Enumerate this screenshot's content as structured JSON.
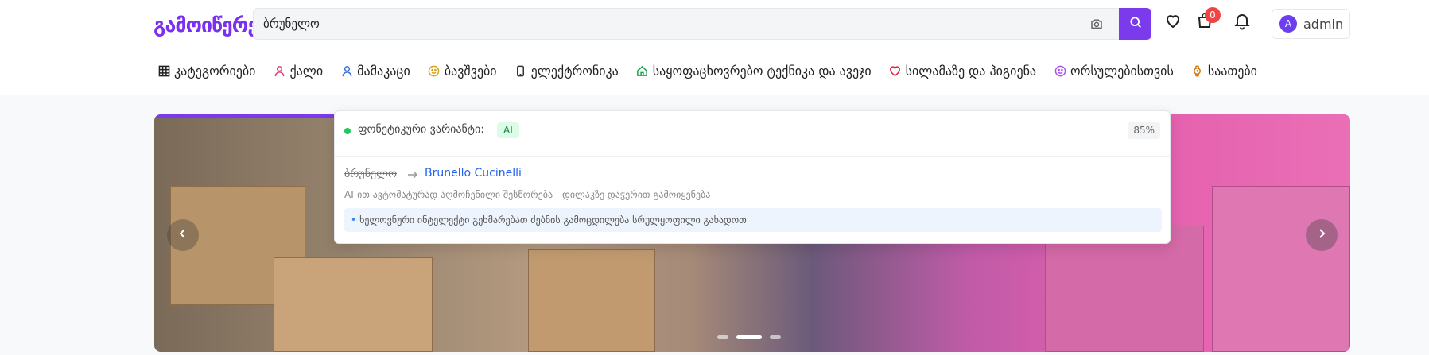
{
  "header": {
    "logo_text": "გამოიწერე",
    "search": {
      "value": "ბრუნელო",
      "placeholder": ""
    },
    "cart_count": "0",
    "account": {
      "avatar_letter": "A",
      "name": "admin"
    }
  },
  "nav": {
    "items": [
      {
        "label": "კატეგორიები",
        "icon": "grid-icon"
      },
      {
        "label": "ქალი",
        "icon": "woman-icon"
      },
      {
        "label": "მამაკაცი",
        "icon": "man-icon"
      },
      {
        "label": "ბავშვები",
        "icon": "smile-icon"
      },
      {
        "label": "ელექტრონიკა",
        "icon": "phone-icon"
      },
      {
        "label": "საყოფაცხოვრებო ტექნიკა და ავეჯი",
        "icon": "home-icon"
      },
      {
        "label": "სილამაზე და ჰიგიენა",
        "icon": "heart-icon"
      },
      {
        "label": "ორსულებისთვის",
        "icon": "baby-icon"
      },
      {
        "label": "საათები",
        "icon": "watch-icon"
      }
    ]
  },
  "suggestion": {
    "title": "ფონეტიკური ვარიანტი:",
    "badge": "AI",
    "confidence": "85%",
    "original": "ბრუნელო",
    "suggested": "Brunello Cucinelli",
    "note": "AI-ით ავტომატურად აღმოჩენილი შესწორება - დილაკზე დაჭერით გამოიყენება",
    "tip": "ხელოვნური ინტელექტი გეხმარებათ ძებნის გამოცდილება სრულყოფილი გახადოთ"
  },
  "banner": {
    "slides": 3,
    "active_slide": 2
  },
  "colors": {
    "accent": "#7c3aed",
    "badge": "#ef4444",
    "link": "#2563eb"
  }
}
